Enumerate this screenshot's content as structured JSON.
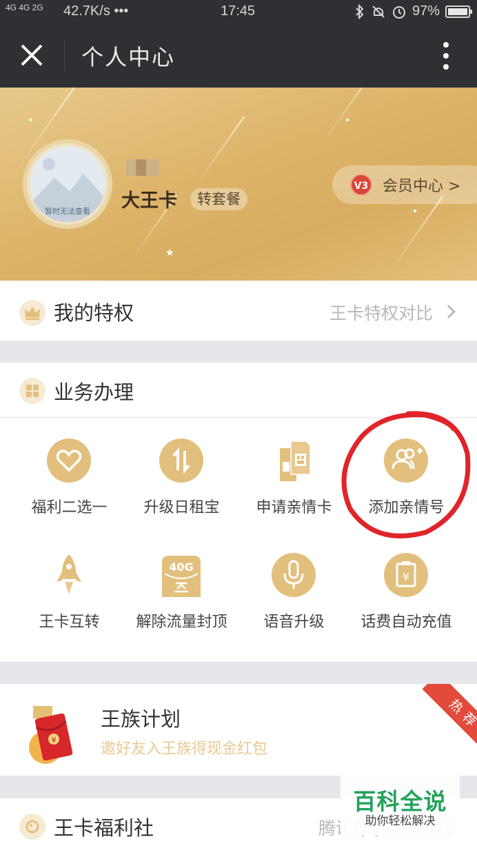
{
  "status_bar": {
    "network": "4G 4G 2G",
    "speed": "42.7K/s •••",
    "time": "17:45",
    "battery": "97%",
    "icons": [
      "bluetooth-icon",
      "mute-icon",
      "alarm-icon",
      "battery-icon"
    ]
  },
  "titlebar": {
    "title": "个人中心",
    "close_icon": "close-icon",
    "more_icon": "more-vertical-icon"
  },
  "profile": {
    "avatar_caption": "暂时无法查看",
    "number_mask": "- - - -",
    "card_name": "大王卡",
    "switch_package": "转套餐",
    "member_badge": "V3",
    "member_label": "会员中心 >"
  },
  "privilege": {
    "title": "我的特权",
    "link": "王卡特权对比"
  },
  "services": {
    "title": "业务办理",
    "items": [
      {
        "label": "福利二选一",
        "icon": "heart-icon"
      },
      {
        "label": "升级日租宝",
        "icon": "swap-arrows-icon"
      },
      {
        "label": "申请亲情卡",
        "icon": "sim-card-icon"
      },
      {
        "label": "添加亲情号",
        "icon": "add-user-icon"
      },
      {
        "label": "王卡互转",
        "icon": "rocket-icon"
      },
      {
        "label": "解除流量封顶",
        "icon": "data-40g-icon",
        "badge": "40G"
      },
      {
        "label": "语音升级",
        "icon": "microphone-icon"
      },
      {
        "label": "话费自动充值",
        "icon": "bill-yuan-icon"
      }
    ]
  },
  "promo": {
    "title": "王族计划",
    "subtitle": "邀好友入王族得现金红包",
    "badge": "热荐"
  },
  "welfare": {
    "title": "王卡福利社",
    "link": "腾讯QQ币88折起"
  },
  "watermark": {
    "title": "百科全说",
    "subtitle": "助你轻松解决"
  },
  "colors": {
    "accent_gold": "#e3bf7e",
    "header_dark": "#2f3033",
    "highlight_red": "#e24a3b",
    "watermark_green": "#23a35b"
  }
}
